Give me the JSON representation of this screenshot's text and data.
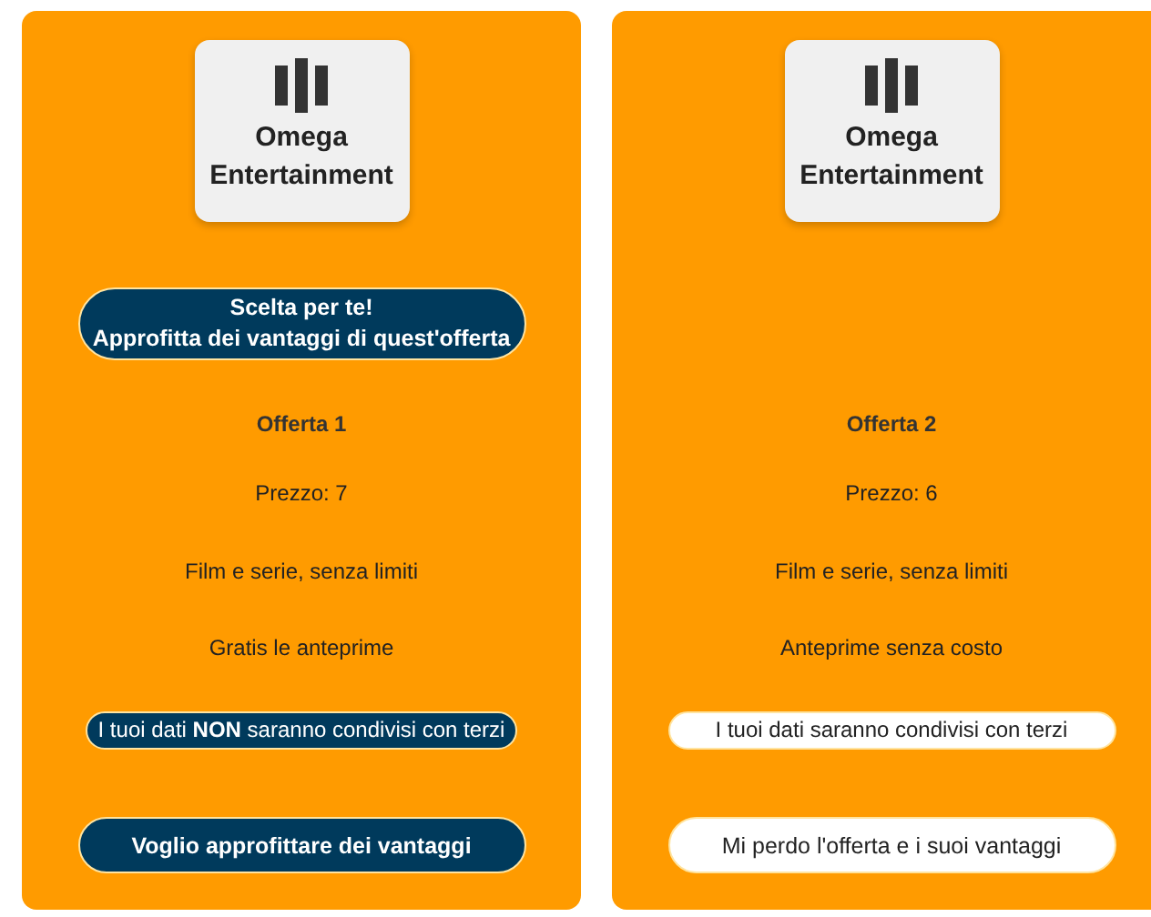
{
  "offers": [
    {
      "brand": "Omega Entertainment",
      "badge": "Scelta per te!\nApprofitta dei vantaggi di quest'offerta",
      "title": "Offerta 1",
      "price": "Prezzo: 7",
      "features": [
        "Film e serie, senza limiti",
        "Gratis le anteprime"
      ],
      "privacy": {
        "text": "I tuoi dati **NON** saranno condivisi con terzi",
        "kind": "dark"
      },
      "cta": {
        "label": "Voglio approfittare dei vantaggi",
        "kind": "dark"
      }
    },
    {
      "brand": "Omega Entertainment",
      "title": "Offerta 2",
      "price": "Prezzo: 6",
      "features": [
        "Film e serie, senza limiti",
        "Anteprime senza costo"
      ],
      "privacy": {
        "text": "I tuoi dati saranno condivisi con terzi",
        "kind": "light"
      },
      "cta": {
        "label": "Mi perdo l'offerta e i suoi vantaggi",
        "kind": "light"
      }
    }
  ]
}
